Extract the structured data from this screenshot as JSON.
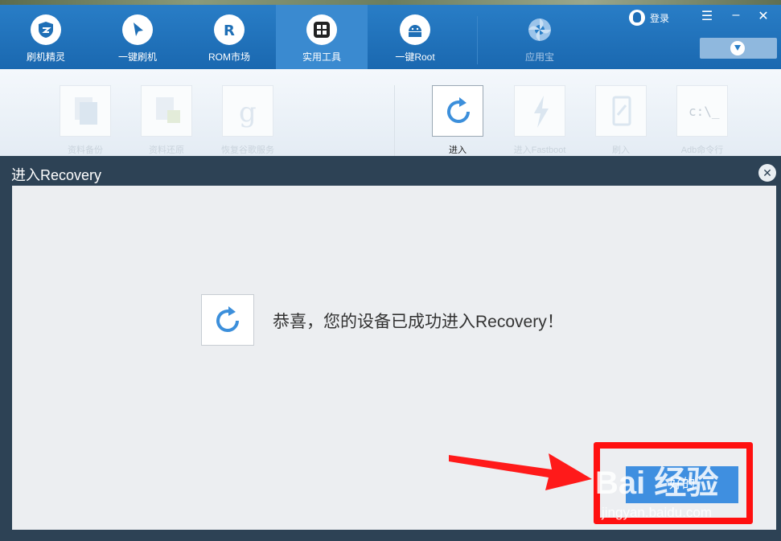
{
  "nav": {
    "items": [
      {
        "label": "刷机精灵",
        "icon": "shield-icon"
      },
      {
        "label": "一键刷机",
        "icon": "cursor-icon"
      },
      {
        "label": "ROM市场",
        "icon": "r-logo-icon"
      },
      {
        "label": "实用工具",
        "icon": "grid-icon",
        "active": true
      },
      {
        "label": "一键Root",
        "icon": "android-icon"
      },
      {
        "label": "应用宝",
        "icon": "yingyongbao-icon"
      }
    ],
    "login_label": "登录",
    "download_icon": "download-icon"
  },
  "tools": {
    "items": [
      {
        "label": "资料备份",
        "icon": "doc-backup-icon"
      },
      {
        "label": "资料还原",
        "icon": "doc-restore-icon"
      },
      {
        "label": "恢复谷歌服务",
        "icon": "google-icon"
      },
      {
        "label": "进入Recovery",
        "icon": "refresh-icon",
        "active": true
      },
      {
        "label": "进入Fastboot",
        "icon": "lightning-icon"
      },
      {
        "label": "刷入Recovery",
        "icon": "tablet-icon"
      },
      {
        "label": "Adb命令行",
        "icon": "terminal-icon",
        "glyph": "c:\\_"
      }
    ]
  },
  "dialog": {
    "title": "进入Recovery",
    "message": "恭喜，您的设备已成功进入Recovery！",
    "ok_label": "好的"
  },
  "watermark": {
    "text": "Bai 经验",
    "url": "jingyan.baidu.com"
  },
  "colors": {
    "nav_bg": "#1f70b8",
    "accent": "#3f8fe0",
    "highlight": "#ff1010",
    "dialog_header": "#2d4255"
  }
}
